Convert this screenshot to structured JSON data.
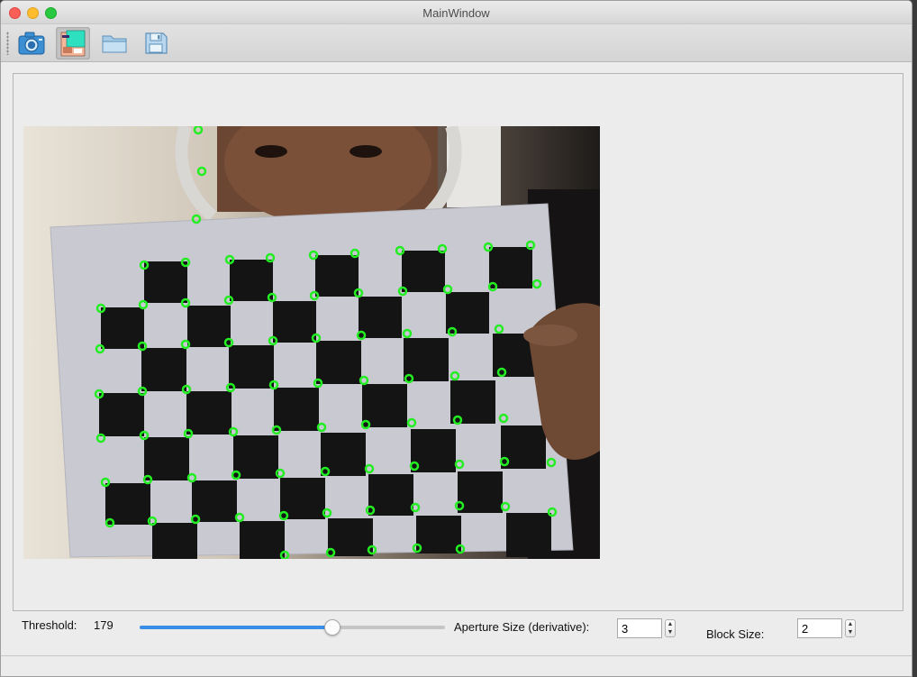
{
  "window": {
    "title": "MainWindow"
  },
  "toolbar": {
    "items": [
      {
        "icon": "camera-icon"
      },
      {
        "icon": "image-icon",
        "active": true
      },
      {
        "icon": "folder-icon"
      },
      {
        "icon": "save-icon"
      }
    ]
  },
  "controls": {
    "threshold_label": "Threshold:",
    "threshold_value": "179",
    "threshold_fraction": 0.63,
    "aperture_label": "Aperture Size (derivative):",
    "aperture_value": "3",
    "block_label": "Block Size:",
    "block_value": "2",
    "spin_up": "▲",
    "spin_down": "▼"
  },
  "colors": {
    "accent": "#3a8ee8",
    "corner_marker": "#22ee22",
    "checker_dark": "#141414",
    "paper": "#c9c9d2"
  }
}
